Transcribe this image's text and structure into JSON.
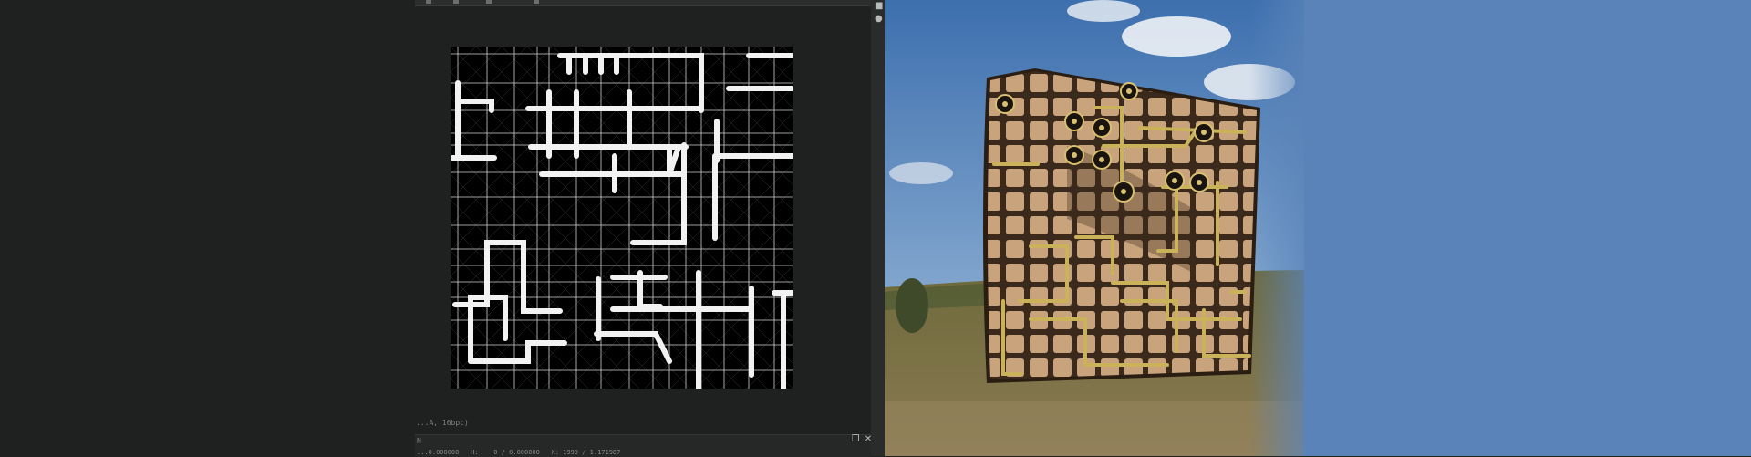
{
  "texture_panel": {
    "format_label": "...A, 16bpc)",
    "status_title": "N",
    "status_values": "...0.000000   H:    0 / 0.000000   X: 1999 / 1.171987"
  },
  "icons": {
    "camera": "camera-icon",
    "bulb": "light-bulb-icon",
    "restore": "restore-window-icon",
    "close": "close-icon"
  },
  "glyphs": {
    "camera": "■",
    "bulb": "●",
    "restore": "❐",
    "close": "✕"
  },
  "colors": {
    "panel_bg": "#1f2120",
    "sky": "#5a84b9",
    "tile": "#c4a07a",
    "brass": "#c9b25a"
  }
}
